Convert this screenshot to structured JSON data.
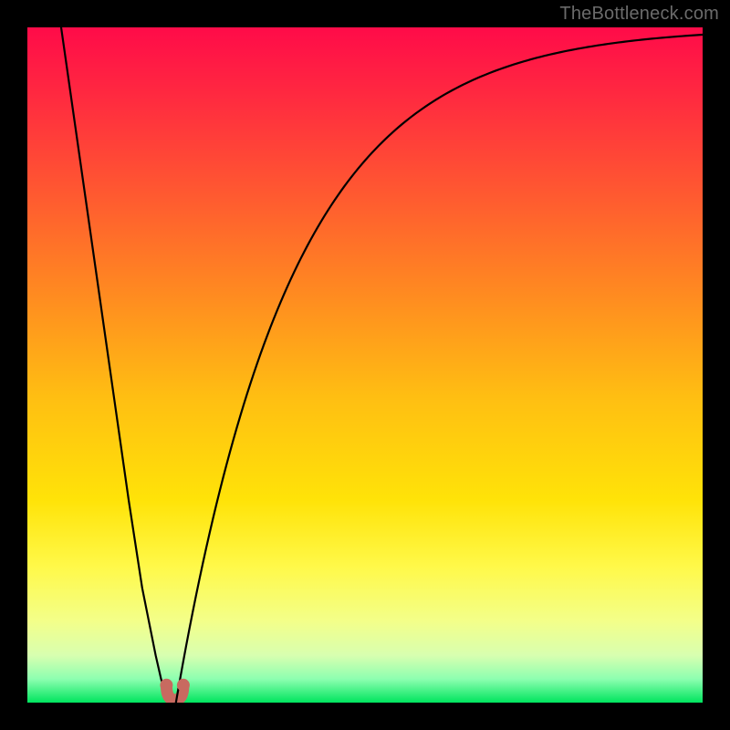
{
  "watermark": "TheBottleneck.com",
  "gradient": {
    "stops": [
      {
        "offset": 0.0,
        "color": "#ff0b49"
      },
      {
        "offset": 0.1,
        "color": "#ff2940"
      },
      {
        "offset": 0.25,
        "color": "#ff5a30"
      },
      {
        "offset": 0.4,
        "color": "#ff8c20"
      },
      {
        "offset": 0.55,
        "color": "#ffbf12"
      },
      {
        "offset": 0.7,
        "color": "#ffe308"
      },
      {
        "offset": 0.8,
        "color": "#fff94a"
      },
      {
        "offset": 0.88,
        "color": "#f3ff8a"
      },
      {
        "offset": 0.93,
        "color": "#d8ffb0"
      },
      {
        "offset": 0.965,
        "color": "#8dffb0"
      },
      {
        "offset": 1.0,
        "color": "#00e55e"
      }
    ]
  },
  "chart_data": {
    "type": "line",
    "title": "",
    "xlabel": "",
    "ylabel": "",
    "x_range": [
      0,
      100
    ],
    "y_range": [
      0,
      100
    ],
    "minimum_x": 21.5,
    "left": {
      "x": [
        5,
        7,
        9,
        11,
        13,
        15,
        17,
        18,
        19,
        19.8,
        20.5,
        21.0
      ],
      "y": [
        100,
        86,
        72,
        58,
        44,
        30,
        17,
        12,
        7,
        3.5,
        1.2,
        0.2
      ]
    },
    "markers": [
      {
        "x": 20.6,
        "y": 2.6
      },
      {
        "x": 23.1,
        "y": 2.6
      }
    ],
    "marker_color": "#c86a60",
    "right_log": {
      "A": 100,
      "k": 0.058,
      "x0": 22.0,
      "x": [
        22.0,
        23,
        24,
        26,
        28,
        31,
        35,
        40,
        46,
        53,
        61,
        70,
        80,
        90,
        100
      ],
      "y": [
        0.2,
        5.6,
        10.9,
        20.7,
        29.4,
        40.7,
        52.6,
        64.8,
        75.2,
        83.4,
        89.6,
        93.8,
        96.6,
        98.1,
        99.0
      ]
    }
  }
}
